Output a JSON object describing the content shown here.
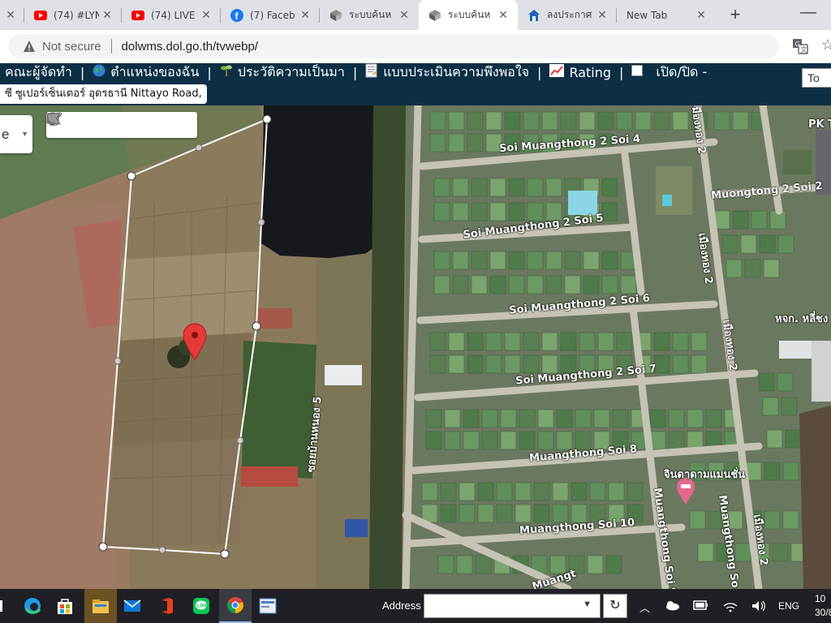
{
  "browser": {
    "tabs": [
      {
        "title": "",
        "favicon": "close-fragment",
        "active": false
      },
      {
        "title": "(74) #LYN",
        "favicon": "youtube-icon",
        "active": false
      },
      {
        "title": "(74) LIVE",
        "favicon": "youtube-icon",
        "active": false
      },
      {
        "title": "(7) Faceb",
        "favicon": "facebook-icon",
        "active": false
      },
      {
        "title": "ระบบค้นห",
        "favicon": "dol-icon",
        "active": false
      },
      {
        "title": "ระบบค้นห",
        "favicon": "dol-icon",
        "active": true
      },
      {
        "title": "ลงประกาศ",
        "favicon": "house-icon",
        "active": false
      },
      {
        "title": "New Tab",
        "favicon": "none",
        "active": false
      }
    ],
    "new_tab_label": "+",
    "not_secure_label": "Not secure",
    "url": "dolwms.dol.go.th/tvwebp/"
  },
  "site": {
    "menu_items": [
      {
        "label": "คณะผู้จัดทำ",
        "icon": ""
      },
      {
        "label": "ตำแหน่งของฉัน",
        "icon": "globe-icon"
      },
      {
        "label": "ประวัติความเป็นมา",
        "icon": "sprout-icon"
      },
      {
        "label": "แบบประเมินความพึงพอใจ",
        "icon": "document-icon"
      },
      {
        "label": "Rating",
        "icon": "chart-icon"
      },
      {
        "label": "เปิด/ปิด -",
        "icon": "checkbox-icon"
      }
    ],
    "search_button_label": "To",
    "address_chip": "ซี ซูเปอร์เซ็นเตอร์ อุดรธานี Nittayo Road,"
  },
  "map": {
    "layer_select_value": "e",
    "draw_tools": [
      "hand-icon",
      "marker-icon",
      "polyline-icon",
      "rectangle-icon",
      "circle-icon",
      "polygon-icon"
    ],
    "labels": {
      "soi4": "Soi Muangthong 2 Soi 4",
      "soi5": "Soi Muangthong 2 Soi 5",
      "soi6": "Soi Muangthong 2 Soi 6",
      "soi7": "Soi Muangthong 2 Soi 7",
      "soi8": "Muangthong Soi 8",
      "soi10": "Muangthong Soi 10",
      "soi9v": "Muangthong Soi 9",
      "soiSmall": "Muangthong So",
      "muongtong2soi2": "Muongtong 2 Soi 2",
      "muangNo2a": "เมืองทอง 2",
      "muangNo2b": "เมืองทอง 2",
      "muangNo2c": "เมืองทอง 2",
      "muangNo2top": "มืองทอง 2",
      "bannong5": "ซอยบ้านหนอง 5",
      "condo": "จินดาดามแมนชั่น",
      "shop": "หจก. หลี่ชง",
      "pk": "PK T",
      "muangt": "Muangt"
    }
  },
  "taskbar": {
    "address_label": "Address",
    "language": "ENG",
    "time": "10",
    "date": "30/8"
  }
}
